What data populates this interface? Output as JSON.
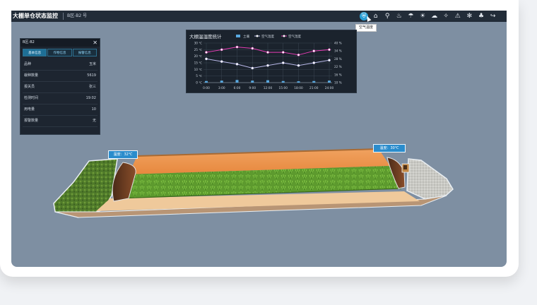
{
  "app": {
    "title": "大棚单仓状态监控",
    "region": "B区-B2 号"
  },
  "toolbar": {
    "tools": [
      {
        "icon": "shield-person-icon",
        "glyph": "⛨",
        "active": true
      },
      {
        "icon": "home-icon",
        "glyph": "⌂",
        "active": false
      },
      {
        "icon": "location-pin-icon",
        "glyph": "⚲",
        "active": false
      },
      {
        "icon": "thermometer-icon",
        "glyph": "♨",
        "active": false
      },
      {
        "icon": "humidity-icon",
        "glyph": "☂",
        "active": false
      },
      {
        "icon": "sun-icon",
        "glyph": "☀",
        "active": false
      },
      {
        "icon": "cloud-icon",
        "glyph": "☁",
        "active": false
      },
      {
        "icon": "lightbulb-icon",
        "glyph": "✧",
        "active": false
      },
      {
        "icon": "warning-icon",
        "glyph": "⚠",
        "active": false
      },
      {
        "icon": "fan-icon",
        "glyph": "✻",
        "active": false
      },
      {
        "icon": "tree-icon",
        "glyph": "♣",
        "active": false
      },
      {
        "icon": "exit-icon",
        "glyph": "↪",
        "active": false
      }
    ],
    "tooltip": "空气温度"
  },
  "panel": {
    "title": "B区-B2",
    "tabs": [
      "基本信息",
      "作物信息",
      "报警信息"
    ],
    "rows": [
      {
        "label": "品种",
        "value": "玉米"
      },
      {
        "label": "栽种数量",
        "value": "5619"
      },
      {
        "label": "报关员",
        "value": "张三"
      },
      {
        "label": "检测时间",
        "value": "19:02"
      },
      {
        "label": "用电量",
        "value": "10"
      },
      {
        "label": "报警数量",
        "value": "无"
      }
    ]
  },
  "chart_data": {
    "type": "line",
    "title": "大棚温湿度统计",
    "legend": [
      "土壤",
      "空气温度",
      "空气湿度"
    ],
    "categories": [
      "0:00",
      "3:00",
      "6:00",
      "9:00",
      "12:00",
      "15:00",
      "18:00",
      "21:00",
      "24:00"
    ],
    "y_left_ticks": [
      "30 ℃",
      "25 ℃",
      "20 ℃",
      "15 ℃",
      "10 ℃",
      "5 ℃",
      "0 ℃"
    ],
    "y_right_ticks": [
      "40 %",
      "34 %",
      "28 %",
      "22 %",
      "16 %",
      "10 %"
    ],
    "ylim_left": [
      0,
      30
    ],
    "ylim_right": [
      10,
      40
    ],
    "series": [
      {
        "name": "土壤",
        "kind": "bar",
        "axis": "left",
        "color": "#59a9e0",
        "values": [
          1.2,
          1.5,
          2.0,
          1.5,
          1.8,
          1.2,
          1.0,
          1.2,
          1.5
        ]
      },
      {
        "name": "空气温度",
        "kind": "line",
        "axis": "left",
        "color": "#b8b8e8",
        "values": [
          18,
          16,
          14,
          11,
          13,
          15,
          13,
          15,
          17
        ]
      },
      {
        "name": "空气湿度",
        "kind": "line",
        "axis": "right",
        "color": "#e63cb5",
        "values": [
          33,
          35,
          37,
          36,
          33,
          33,
          31,
          34,
          35
        ]
      }
    ]
  },
  "scene": {
    "left_tag": "温度：32℃",
    "right_tag": "温度：30℃"
  },
  "colors": {
    "accent": "#2a9fd6",
    "background": "#7e8fa2",
    "panel": "#1d2530"
  }
}
